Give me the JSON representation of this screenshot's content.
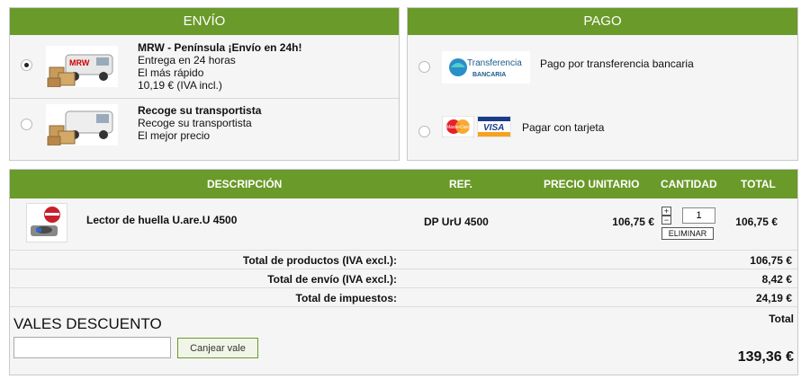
{
  "envio": {
    "title": "ENVÍO",
    "options": [
      {
        "name": "MRW - Península ¡Envío en 24h!",
        "line1": "Entrega en 24 horas",
        "line2": "El más rápido",
        "line3": "10,19 € (IVA incl.)",
        "selected": true,
        "logo": "MRW"
      },
      {
        "name": "Recoge su transportista",
        "line1": "Recoge su transportista",
        "line2": "El mejor precio",
        "selected": false
      }
    ]
  },
  "pago": {
    "title": "PAGO",
    "options": [
      {
        "label": "Pago por transferencia bancaria",
        "logo_top": "Transferencia",
        "logo_bottom": "BANCARIA",
        "selected": false
      },
      {
        "label": "Pagar con tarjeta",
        "logo_mc": "MasterCard",
        "logo_visa": "VISA",
        "selected": false
      }
    ]
  },
  "cart": {
    "headers": {
      "descripcion": "DESCRIPCIÓN",
      "ref": "REF.",
      "precio": "PRECIO UNITARIO",
      "cantidad": "CANTIDAD",
      "total": "TOTAL"
    },
    "item": {
      "name": "Lector de huella U.are.U 4500",
      "ref": "DP UrU 4500",
      "price": "106,75 €",
      "qty": "1",
      "total": "106,75 €",
      "remove": "ELIMINAR",
      "plus": "+",
      "minus": "−"
    },
    "summary": [
      {
        "label": "Total de productos (IVA excl.):",
        "value": "106,75 €"
      },
      {
        "label": "Total de envío (IVA excl.):",
        "value": "8,42 €"
      },
      {
        "label": "Total de impuestos:",
        "value": "24,19 €"
      }
    ],
    "voucher": {
      "title": "VALES DESCUENTO",
      "input_value": "",
      "button": "Canjear vale"
    },
    "grand_total_label": "Total",
    "grand_total": "139,36 €"
  },
  "colors": {
    "header_green": "#6a9a2a",
    "panel_bg": "#f5f5f5"
  }
}
